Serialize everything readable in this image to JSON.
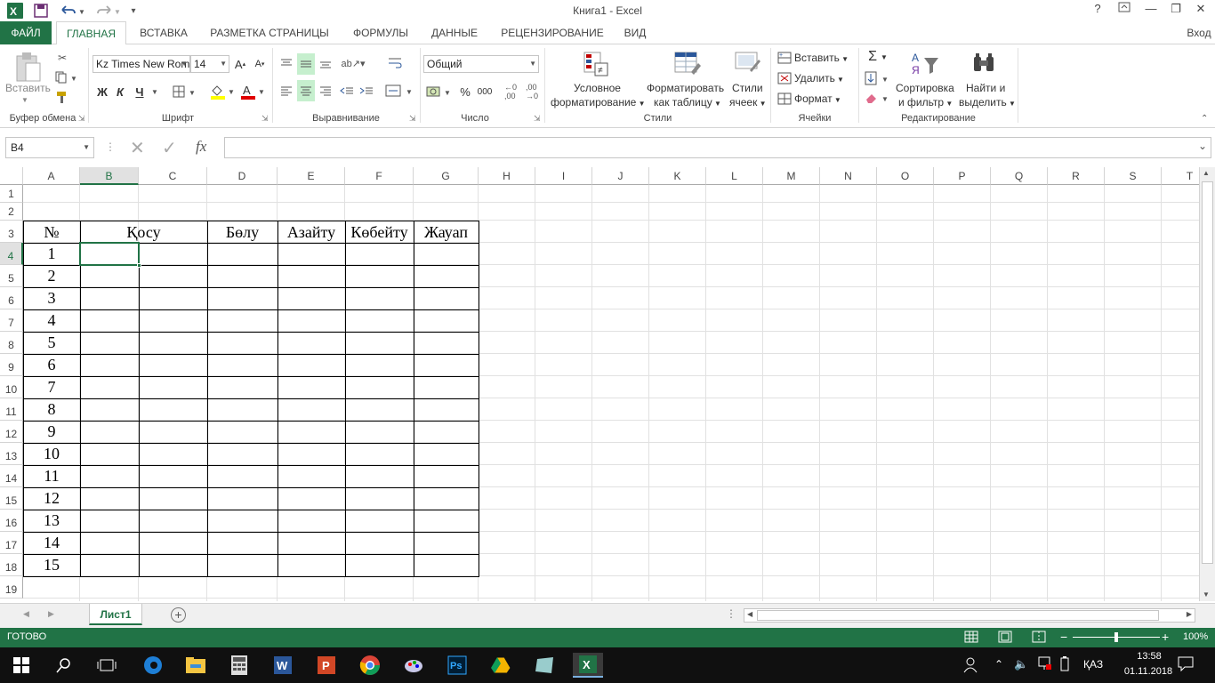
{
  "window": {
    "title": "Книга1 - Excel",
    "help": "?",
    "signin": "Вход"
  },
  "tabs": [
    "ФАЙЛ",
    "ГЛАВНАЯ",
    "ВСТАВКА",
    "РАЗМЕТКА СТРАНИЦЫ",
    "ФОРМУЛЫ",
    "ДАННЫЕ",
    "РЕЦЕНЗИРОВАНИЕ",
    "ВИД"
  ],
  "active_tab": "ГЛАВНАЯ",
  "ribbon": {
    "clipboard": {
      "paste": "Вставить",
      "label": "Буфер обмена"
    },
    "font": {
      "name": "Kz Times New Roman",
      "size": "14",
      "bold": "Ж",
      "italic": "К",
      "underline": "Ч",
      "label": "Шрифт"
    },
    "alignment": {
      "label": "Выравнивание"
    },
    "number": {
      "format": "Общий",
      "percent": "%",
      "thousands": "000",
      "label": "Число"
    },
    "styles": {
      "conditional": "Условное",
      "conditional2": "форматирование",
      "table": "Форматировать",
      "table2": "как таблицу",
      "cell": "Стили",
      "cell2": "ячеек",
      "label": "Стили"
    },
    "cells": {
      "insert": "Вставить",
      "delete": "Удалить",
      "format": "Формат",
      "label": "Ячейки"
    },
    "editing": {
      "sort": "Сортировка",
      "sort2": "и фильтр",
      "find": "Найти и",
      "find2": "выделить",
      "label": "Редактирование"
    }
  },
  "formula_bar": {
    "name_box": "B4",
    "fx": "fx",
    "value": ""
  },
  "columns": [
    "A",
    "B",
    "C",
    "D",
    "E",
    "F",
    "G",
    "H",
    "I",
    "J",
    "K",
    "L",
    "M",
    "N",
    "O",
    "P",
    "Q",
    "R",
    "S",
    "T"
  ],
  "selected_column": "B",
  "selected_row": 4,
  "rows": [
    "1",
    "2",
    "3",
    "4",
    "5",
    "6",
    "7",
    "8",
    "9",
    "10",
    "11",
    "12",
    "13",
    "14",
    "15",
    "16",
    "17",
    "18",
    "19"
  ],
  "table": {
    "headers": [
      "№",
      "Қосу",
      "Бөлу",
      "Азайту",
      "Көбейту",
      "Жауап"
    ],
    "numbers": [
      "1",
      "2",
      "3",
      "4",
      "5",
      "6",
      "7",
      "8",
      "9",
      "10",
      "11",
      "12",
      "13",
      "14",
      "15"
    ]
  },
  "sheets": [
    {
      "name": "Лист1",
      "active": true
    }
  ],
  "status": {
    "mode": "ГОТОВО",
    "zoom": "100%",
    "zoom_level": 100
  },
  "taskbar": {
    "language": "ҚАЗ",
    "time": "13:58",
    "date": "01.11.2018"
  },
  "colors": {
    "accent": "#217346"
  }
}
